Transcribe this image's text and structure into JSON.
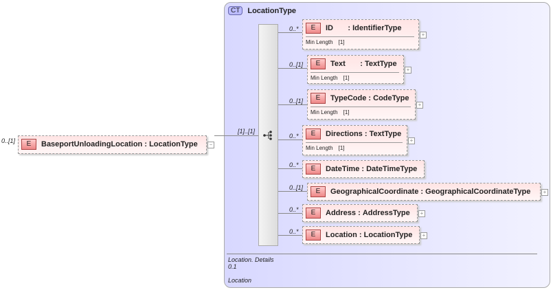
{
  "root": {
    "occurrence": "0..[1]",
    "name": "BaseportUnloadingLocation",
    "type": "LocationType",
    "badge": "E"
  },
  "sequence": {
    "occurrence": "[1]..[1]"
  },
  "complex_type": {
    "badge": "CT",
    "name": "LocationType"
  },
  "children": [
    {
      "occurrence": "0..*",
      "name": "ID",
      "type": "IdentifierType",
      "facet": "Min Length",
      "facet_value": "[1]"
    },
    {
      "occurrence": "0..[1]",
      "name": "Text",
      "type": "TextType",
      "facet": "Min Length",
      "facet_value": "[1]"
    },
    {
      "occurrence": "0..[1]",
      "name": "TypeCode",
      "type": "CodeType",
      "facet": "Min Length",
      "facet_value": "[1]"
    },
    {
      "occurrence": "0..*",
      "name": "Directions",
      "type": "TextType",
      "facet": "Min Length",
      "facet_value": "[1]"
    },
    {
      "occurrence": "0..*",
      "name": "DateTime",
      "type": "DateTimeType"
    },
    {
      "occurrence": "0..[1]",
      "name": "GeographicalCoordinate",
      "type": "GeographicalCoordinateType"
    },
    {
      "occurrence": "0..*",
      "name": "Address",
      "type": "AddressType"
    },
    {
      "occurrence": "0..*",
      "name": "Location",
      "type": "LocationType"
    }
  ],
  "footer": {
    "line1": "Location. Details",
    "line2": "0.1",
    "line3": "Location"
  },
  "element_badge": "E"
}
